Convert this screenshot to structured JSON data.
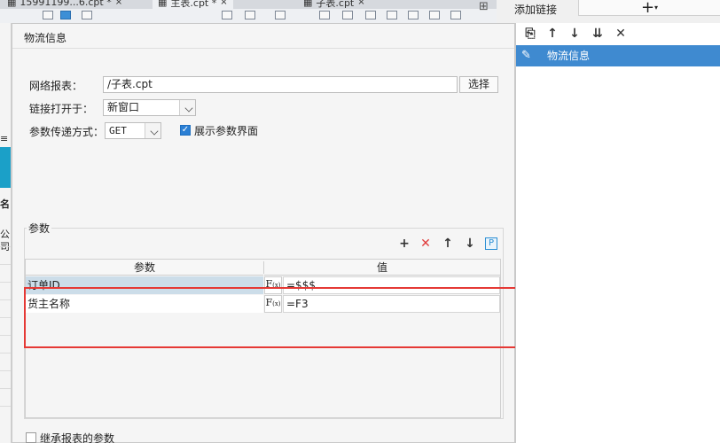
{
  "tabs": [
    {
      "label": "15991199...6.cpt *",
      "close": "×"
    },
    {
      "label": "主表.cpt *",
      "close": "×"
    },
    {
      "label": "子表.cpt",
      "close": "×"
    }
  ],
  "left_strip": {
    "label_name": "名",
    "label_company": "公司"
  },
  "dialog": {
    "title": "物流信息",
    "report_label": "网络报表：",
    "report_value": "/子表.cpt",
    "select_button": "选择",
    "open_in_label": "链接打开于：",
    "open_in_value": "新窗口",
    "param_method_label": "参数传递方式：",
    "param_method_value": "GET",
    "show_params_checked": true,
    "show_params_label": "展示参数界面",
    "params_group_label": "参数",
    "toolbar": {
      "add": "+",
      "delete": "✕",
      "up": "↑",
      "down": "↓",
      "p": "P"
    },
    "table": {
      "headers": [
        "参数",
        "值"
      ],
      "rows": [
        {
          "param": "订单ID",
          "value": "=$$$"
        },
        {
          "param": "货主名称",
          "value": "=F3"
        }
      ]
    },
    "inherit_label": "继承报表的参数",
    "inherit_checked": false
  },
  "right_panel": {
    "title": "添加链接",
    "add_button": "+",
    "toolbar": {
      "copy": "⎘",
      "up": "↑",
      "down": "↓",
      "bottom": "⇊",
      "delete": "✕"
    },
    "items": [
      {
        "label": "物流信息",
        "selected": true
      }
    ]
  }
}
